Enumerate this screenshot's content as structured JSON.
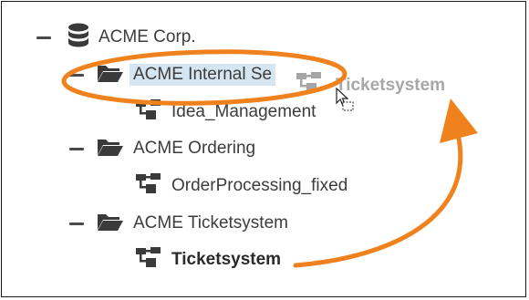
{
  "tree": {
    "root": {
      "label": "ACME Corp.",
      "icon": "database-icon"
    },
    "folders": [
      {
        "label": "ACME Internal Services",
        "visible_label": "ACME Internal Se",
        "icon": "folder-open-icon",
        "selected": true,
        "children": [
          {
            "label": "Idea_Management",
            "icon": "process-icon"
          }
        ]
      },
      {
        "label": "ACME Ordering",
        "icon": "folder-open-icon",
        "children": [
          {
            "label": "OrderProcessing_fixed",
            "icon": "process-icon"
          }
        ]
      },
      {
        "label": "ACME Ticketsystem",
        "icon": "folder-open-icon",
        "children": [
          {
            "label": "Ticketsystem",
            "icon": "process-icon",
            "bold": true
          }
        ]
      }
    ]
  },
  "drag_ghost": {
    "label": "Ticketsystem",
    "icon": "process-icon",
    "cursor": "copy-cursor-icon"
  },
  "annotation": {
    "color": "#f0821e",
    "shapes": [
      "ellipse-highlight",
      "curved-arrow"
    ]
  },
  "colors": {
    "icon": "#3a3a3a",
    "selection": "#d5e6f2",
    "ghost_text": "#8a8a8a"
  }
}
